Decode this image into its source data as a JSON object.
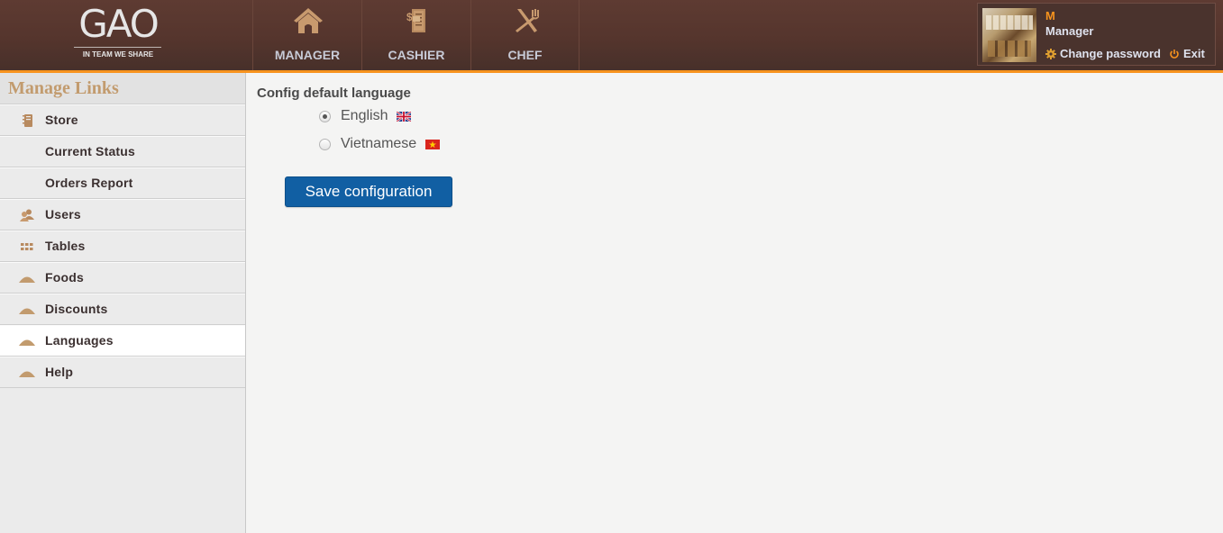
{
  "header": {
    "logo": {
      "name": "GAO",
      "tagline": "IN TEAM WE SHARE"
    },
    "nav": [
      {
        "label": "MANAGER",
        "icon": "house-icon"
      },
      {
        "label": "CASHIER",
        "icon": "receipt-icon"
      },
      {
        "label": "CHEF",
        "icon": "utensils-icon"
      }
    ],
    "user": {
      "initial": "M",
      "role": "Manager",
      "change_password": "Change password",
      "exit": "Exit"
    }
  },
  "sidebar": {
    "title": "Manage Links",
    "items": [
      {
        "label": "Store",
        "icon": "notebook-icon",
        "active": false
      },
      {
        "label": "Current Status",
        "icon": "",
        "active": false
      },
      {
        "label": "Orders Report",
        "icon": "",
        "active": false
      },
      {
        "label": "Users",
        "icon": "users-icon",
        "active": false
      },
      {
        "label": "Tables",
        "icon": "grid-icon",
        "active": false
      },
      {
        "label": "Foods",
        "icon": "cloche-icon",
        "active": false
      },
      {
        "label": "Discounts",
        "icon": "cloche-icon",
        "active": false
      },
      {
        "label": "Languages",
        "icon": "cloche-icon",
        "active": true
      },
      {
        "label": "Help",
        "icon": "cloche-icon",
        "active": false
      }
    ]
  },
  "main": {
    "title": "Config default language",
    "options": [
      {
        "label": "English",
        "flag": "uk-flag-icon",
        "checked": true
      },
      {
        "label": "Vietnamese",
        "flag": "vietnam-flag-icon",
        "checked": false
      }
    ],
    "save_label": "Save configuration"
  },
  "colors": {
    "header_bg": "#55352d",
    "accent": "#f7931e",
    "icon_tan": "#c29b6e",
    "button_blue": "#115fa3"
  }
}
